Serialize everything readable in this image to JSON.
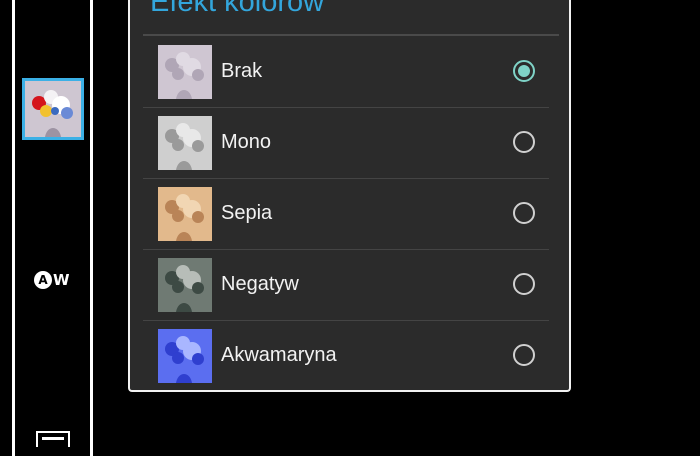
{
  "dialog": {
    "title": "Efekt kolorów",
    "options": [
      {
        "label": "Brak",
        "selected": true,
        "thumb_colors": [
          "#cfc6d2",
          "#e0dae3",
          "#b0a6b6"
        ]
      },
      {
        "label": "Mono",
        "selected": false,
        "thumb_colors": [
          "#cfcfcf",
          "#e8e8e8",
          "#9a9a9a"
        ]
      },
      {
        "label": "Sepia",
        "selected": false,
        "thumb_colors": [
          "#e2b98c",
          "#f1d6b3",
          "#b98457"
        ]
      },
      {
        "label": "Negatyw",
        "selected": false,
        "thumb_colors": [
          "#6f7a73",
          "#b7bdb8",
          "#3d4a44"
        ]
      },
      {
        "label": "Akwamaryna",
        "selected": false,
        "thumb_colors": [
          "#5b6ef0",
          "#a9b6ff",
          "#2f3fcf"
        ]
      }
    ]
  },
  "sidebar": {
    "active_effect_icon": "color-effect-thumbnail",
    "aw_label": "AW",
    "accent_color": "#3bb0e6"
  },
  "colors": {
    "radio_selected": "#7fd3c7",
    "title": "#33a6dc",
    "dialog_bg": "#2b2b2b"
  }
}
